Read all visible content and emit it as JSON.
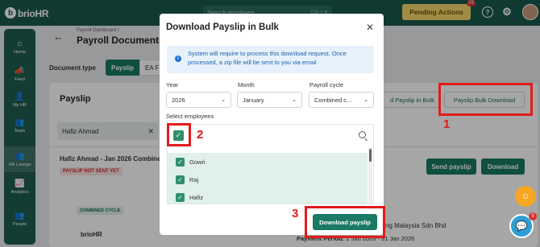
{
  "app": {
    "logo_mark": "b",
    "logo_text": "brio",
    "logo_suffix": "HR",
    "search_placeholder": "Search employee",
    "search_shortcut": "Ctrl + K",
    "pending_label": "Pending Actions",
    "pending_count": "29",
    "help_icon_glyph": "?",
    "settings_icon_glyph": "⚙"
  },
  "sidebar": {
    "items": [
      {
        "label": "Home",
        "icon": "home-icon",
        "glyph": "⌂"
      },
      {
        "label": "Feed",
        "icon": "megaphone-icon",
        "glyph": "📣"
      },
      {
        "label": "My HR",
        "icon": "person-icon",
        "glyph": "👤"
      },
      {
        "label": "Team",
        "icon": "team-icon",
        "glyph": "👥"
      },
      {
        "label": "HR Lounge",
        "icon": "lounge-icon",
        "glyph": "👥"
      },
      {
        "label": "Analytics",
        "icon": "analytics-icon",
        "glyph": "📈"
      },
      {
        "label": "People",
        "icon": "people-icon",
        "glyph": "👥"
      }
    ]
  },
  "page": {
    "breadcrumb": "Payroll Dashboard /",
    "title": "Payroll Documents",
    "doc_type_label": "Document type",
    "tab_payslip": "Payslip",
    "tab_ea": "EA F",
    "card_title": "Payslip",
    "btn_partial_bulk": "d Payslip in Bulk",
    "btn_bulk_download": "Payslip Bulk Download",
    "filter_value": "Hafiz Ahmad",
    "employee_row": "Hafiz Ahmad - Jan 2026 Combine",
    "status_badge": "PAYSLIP NOT SENT YET",
    "btn_send": "Send payslip",
    "btn_download": "Download",
    "cycle_badge": "COMBINED CYCLE",
    "small_logo": "brioHR",
    "company": "ng Malaysia Sdn Bhd",
    "pay_period_label": "Payment Period:",
    "pay_period_value": " 1 Jan 2026 - 31 Jan 2026"
  },
  "modal": {
    "title": "Download Payslip in Bulk",
    "close_glyph": "✕",
    "info_text": "System will require to process this download request. Once processed, a zip file will be sent to you via email",
    "year_label": "Year",
    "year_value": "2026",
    "month_label": "Month",
    "month_value": "January",
    "cycle_label": "Payroll cycle",
    "cycle_value": "Combined c...",
    "select_employees_label": "Select employees",
    "search_value": "",
    "employees": [
      "Gowri",
      "Raj",
      "Hafiz"
    ],
    "download_button": "Download payslip"
  },
  "annotations": {
    "step1": "1",
    "step2": "2",
    "step3": "3"
  },
  "chat_badge": "5",
  "colors": {
    "brand_dark": "#1a5a4c",
    "accent_green": "#1a7a63",
    "annotation_red": "#e11b1b",
    "pending_yellow": "#f6d86a"
  }
}
